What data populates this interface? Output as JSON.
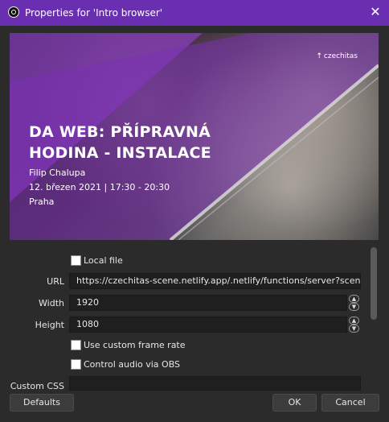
{
  "window": {
    "title": "Properties for 'Intro browser'",
    "icon": "obs-logo-icon",
    "close_icon": "close-icon"
  },
  "preview": {
    "logo_text": "czechitas",
    "title_line1": "DA WEB: PŘÍPRAVNÁ",
    "title_line2": "HODINA - INSTALACE",
    "presenter": "Filip Chalupa",
    "datetime": "12. březen 2021 | 17:30 - 20:30",
    "location": "Praha"
  },
  "form": {
    "local_file_label": "Local file",
    "local_file_checked": false,
    "url_label": "URL",
    "url_value": "https://czechitas-scene.netlify.app/.netlify/functions/server?scene=intro",
    "width_label": "Width",
    "width_value": "1920",
    "height_label": "Height",
    "height_value": "1080",
    "custom_fps_label": "Use custom frame rate",
    "custom_fps_checked": false,
    "control_audio_label": "Control audio via OBS",
    "control_audio_checked": false,
    "custom_css_label": "Custom CSS",
    "custom_css_value": ""
  },
  "buttons": {
    "defaults": "Defaults",
    "ok": "OK",
    "cancel": "Cancel"
  },
  "colors": {
    "titlebar": "#6a2fb0",
    "background": "#2b2b2b",
    "input_bg": "#1f1f1f",
    "overlay_purple": "#8a3fc0"
  }
}
